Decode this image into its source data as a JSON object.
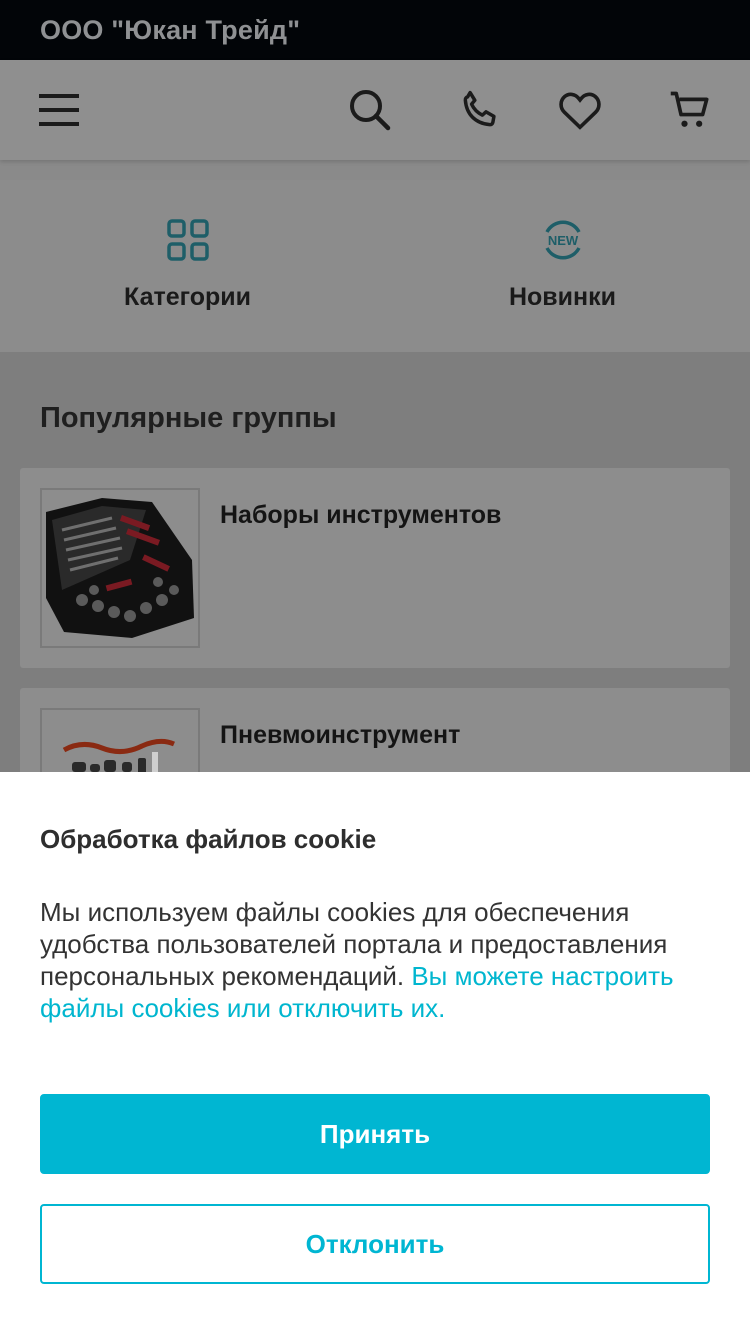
{
  "topbar": {
    "company": "ООО \"Юкан Трейд\""
  },
  "header": {
    "icons": [
      "menu-icon",
      "search-icon",
      "phone-icon",
      "heart-icon",
      "cart-icon"
    ]
  },
  "quick_nav": {
    "categories_label": "Категории",
    "new_label": "Новинки",
    "new_badge": "NEW"
  },
  "popular": {
    "title": "Популярные группы",
    "groups": [
      {
        "name": "Наборы инструментов"
      },
      {
        "name": "Пневмоинструмент"
      }
    ]
  },
  "cookie": {
    "title": "Обработка файлов cookie",
    "text": "Мы используем файлы cookies для обеспечения удобства пользователей портала и предоставления персональных рекомендаций.",
    "link_text": "Вы можете настроить файлы cookies или отключить их.",
    "accept_label": "Принять",
    "decline_label": "Отклонить"
  },
  "colors": {
    "accent": "#00b6d2",
    "overlay_dim": "#8a8a8a",
    "topbar": "#020508",
    "icon_teal": "#1e5e68"
  }
}
